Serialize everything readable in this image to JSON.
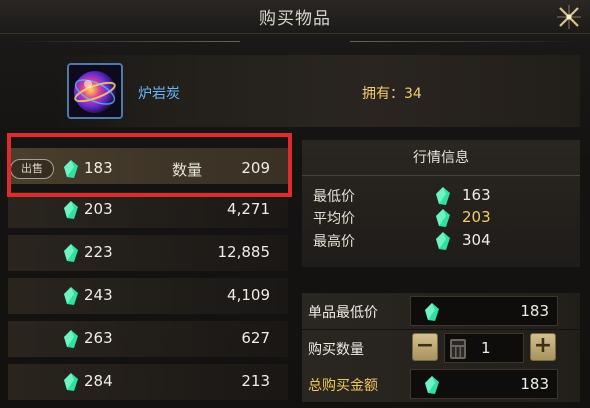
{
  "window": {
    "title": "购买物品"
  },
  "item": {
    "name": "炉岩炭",
    "owned_label": "拥有：34"
  },
  "listings": {
    "sell_tag": "出售",
    "qty_label": "数量",
    "rows": [
      {
        "price": "183",
        "qty": "209"
      },
      {
        "price": "203",
        "qty": "4,271"
      },
      {
        "price": "223",
        "qty": "12,885"
      },
      {
        "price": "243",
        "qty": "4,109"
      },
      {
        "price": "263",
        "qty": "627"
      },
      {
        "price": "284",
        "qty": "213"
      }
    ]
  },
  "market": {
    "heading": "行情信息",
    "lowest_label": "最低价",
    "lowest_value": "163",
    "average_label": "平均价",
    "average_value": "203",
    "highest_label": "最高价",
    "highest_value": "304"
  },
  "purchase": {
    "unit_price_label": "单品最低价",
    "unit_price": "183",
    "quantity_label": "购买数量",
    "quantity": "1",
    "minus_label": "−",
    "plus_label": "+",
    "total_label": "总购买金额",
    "total": "183"
  },
  "colors": {
    "accent_blue": "#67b6ff",
    "gold": "#f4cc6a",
    "highlight": "#e02b2b",
    "gem": "#2fe0a0"
  },
  "icons": {
    "currency": "green-gem-icon",
    "close": "close-x-icon",
    "calculator": "calculator-icon"
  }
}
